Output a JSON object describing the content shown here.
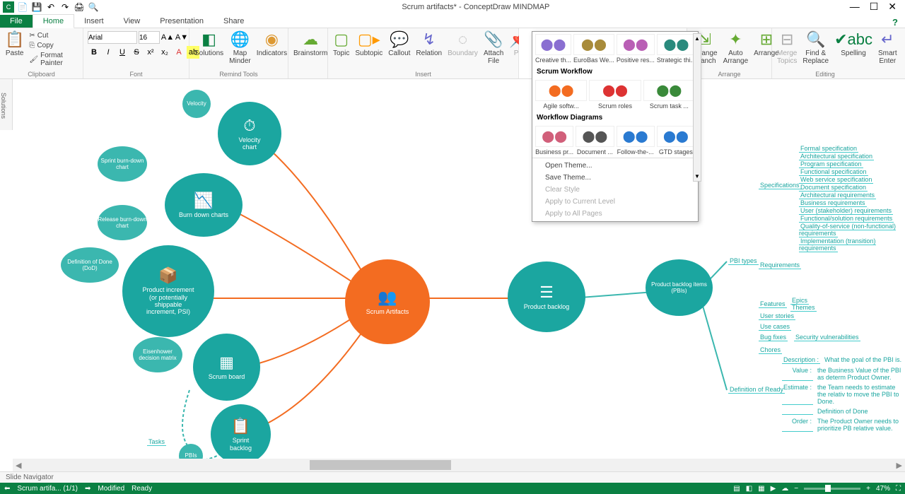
{
  "title": "Scrum artifacts* - ConceptDraw MINDMAP",
  "qat": {
    "icons": [
      "app",
      "new",
      "save",
      "undo",
      "redo",
      "print",
      "preview"
    ]
  },
  "win": {
    "min": "—",
    "max": "☐",
    "close": "✕"
  },
  "tabs": {
    "file": "File",
    "home": "Home",
    "insert": "Insert",
    "view": "View",
    "presentation": "Presentation",
    "share": "Share"
  },
  "ribbon": {
    "clipboard": {
      "label": "Clipboard",
      "paste": "Paste",
      "cut": "Cut",
      "copy": "Copy",
      "fmt": "Format Painter"
    },
    "font": {
      "label": "Font",
      "name": "Arial",
      "size": "16"
    },
    "remind": {
      "label": "Remind Tools",
      "solutions": "Solutions",
      "map_minder": "Map\nMinder",
      "indicators": "Indicators"
    },
    "brainstorm": "Brainstorm",
    "insert": {
      "label": "Insert",
      "topic": "Topic",
      "subtopic": "Subtopic",
      "callout": "Callout",
      "relation": "Relation",
      "boundary": "Boundary",
      "attach": "Attach\nFile",
      "pin": "Pin"
    },
    "arrange": {
      "label": "Arrange",
      "arrange_branch": "Arrange\nBranch",
      "auto": "Auto\nArrange",
      "arrange": "Arrange"
    },
    "editing": {
      "label": "Editing",
      "merge": "Merge\nTopics",
      "find": "Find &\nReplace",
      "spelling": "Spelling",
      "smart": "Smart\nEnter"
    }
  },
  "gallery": {
    "row1": [
      {
        "cap": "Creative th...",
        "color": "#8a6fd1"
      },
      {
        "cap": "EuroBas We...",
        "color": "#a88b3a"
      },
      {
        "cap": "Positive res...",
        "color": "#b95fb5"
      },
      {
        "cap": "Strategic thi...",
        "color": "#2a8a7d"
      }
    ],
    "head_scrum": "Scrum Workflow",
    "row2": [
      {
        "cap": "Agile softw...",
        "color": "#f36c21"
      },
      {
        "cap": "Scrum roles",
        "color": "#d33"
      },
      {
        "cap": "Scrum task ...",
        "color": "#3a8a3a"
      }
    ],
    "head_wf": "Workflow Diagrams",
    "row3": [
      {
        "cap": "Business pr...",
        "color": "#d15f7a"
      },
      {
        "cap": "Document ...",
        "color": "#555"
      },
      {
        "cap": "Follow-the-...",
        "color": "#2a7ad1"
      },
      {
        "cap": "GTD stages",
        "color": "#2a7ad1"
      }
    ],
    "menu": {
      "open": "Open Theme...",
      "save": "Save Theme...",
      "clear": "Clear Style",
      "apply_level": "Apply to Current Level",
      "apply_all": "Apply to All Pages"
    }
  },
  "sidebar_tab": "Solutions",
  "mindmap": {
    "center": "Scrum Artifacts",
    "velocity": "Velocity",
    "velocity_chart": "Velocity\nchart",
    "sprint_bd": "Sprint burn-down\nchart",
    "burn_down": "Burn down charts",
    "release_bd": "Release burn-down\nchart",
    "dod": "Definition of Done\n(DoD)",
    "psi": "Product increment\n(or potentially\nshippable\nincrement, PSI)",
    "eisenhower": "Eisenhower\ndecision matrix",
    "scrum_board": "Scrum board",
    "sprint_backlog": "Sprint\nbacklog",
    "tasks": "Tasks",
    "pbis_small": "PBIs",
    "product_backlog": "Product backlog",
    "pbis_big": "Product backlog items\n(PBIs)"
  },
  "right_tree": {
    "pbi_types": "PBI types",
    "specs": "Specifications",
    "specs_items": [
      "Formal specification",
      "Architectural specification",
      "Program specification",
      "Functional specification",
      "Web service specification",
      "Document specification",
      "Architectural requirements",
      "Business requirements",
      "User (stakeholder) requirements",
      "Functional/solution requirements",
      "Quality-of-service (non-functional) requirements",
      "Implementation (transition) requirements"
    ],
    "requirements": "Requirements",
    "features": "Features",
    "features_items": [
      "Epics",
      "Themes"
    ],
    "user_stories": "User stories",
    "use_cases": "Use cases",
    "bug_fixes": "Bug fixes",
    "sv": "Security vulnerabilities",
    "chores": "Chores",
    "dor": "Definition of Ready",
    "dor_items": [
      {
        "k": "Description :",
        "v": "What the goal of the PBI is."
      },
      {
        "k": "Value :",
        "v": "the Business Value of the PBI as determ Product Owner."
      },
      {
        "k": "Estimate :",
        "v": "the Team needs to estimate the relativ to move the PBI to Done."
      },
      {
        "k": "",
        "v": "Definition of Done"
      },
      {
        "k": "Order :",
        "v": "The Product Owner needs to prioritize PB relative value."
      }
    ]
  },
  "slidenav": "Slide Navigator",
  "status": {
    "doc": "Scrum artifa... (1/1)",
    "modified": "Modified",
    "ready": "Ready",
    "zoom": "47%"
  }
}
